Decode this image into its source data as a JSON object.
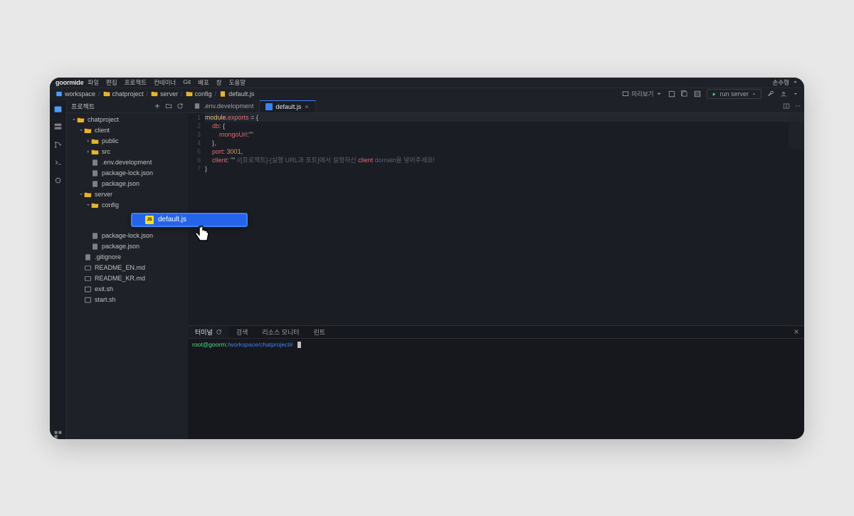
{
  "topbar": {
    "logo": "goormide",
    "menu": [
      "파일",
      "편집",
      "프로젝트",
      "컨테이너",
      "Git",
      "배포",
      "창",
      "도움말"
    ],
    "user": "손수형"
  },
  "breadcrumb": {
    "items": [
      {
        "icon": "container",
        "label": "workspace"
      },
      {
        "icon": "folder",
        "label": "chatproject"
      },
      {
        "icon": "folder",
        "label": "server"
      },
      {
        "icon": "folder",
        "label": "config"
      },
      {
        "icon": "file",
        "label": "default.js"
      }
    ]
  },
  "toolbar": {
    "preview": "미리보기",
    "run": "run server"
  },
  "sidebar": {
    "title": "프로젝트",
    "tree": [
      {
        "d": 0,
        "t": "folder",
        "open": true,
        "label": "chatproject"
      },
      {
        "d": 1,
        "t": "folder",
        "open": true,
        "label": "client"
      },
      {
        "d": 2,
        "t": "folder",
        "open": false,
        "label": "public"
      },
      {
        "d": 2,
        "t": "folder",
        "open": false,
        "label": "src"
      },
      {
        "d": 2,
        "t": "file",
        "label": ".env.development"
      },
      {
        "d": 2,
        "t": "file",
        "label": "package-lock.json"
      },
      {
        "d": 2,
        "t": "file",
        "label": "package.json"
      },
      {
        "d": 1,
        "t": "folder",
        "open": true,
        "label": "server"
      },
      {
        "d": 2,
        "t": "folder",
        "open": true,
        "label": "config"
      },
      {
        "d": 3,
        "t": "file",
        "label": "default.js",
        "selected": true
      },
      {
        "d": 2,
        "t": "file",
        "label": "package-lock.json"
      },
      {
        "d": 2,
        "t": "file",
        "label": "package.json"
      },
      {
        "d": 1,
        "t": "file",
        "label": ".gitignore"
      },
      {
        "d": 1,
        "t": "md",
        "label": "README_EN.md"
      },
      {
        "d": 1,
        "t": "md",
        "label": "README_KR.md"
      },
      {
        "d": 1,
        "t": "sh",
        "label": "exit.sh"
      },
      {
        "d": 1,
        "t": "sh",
        "label": "start.sh"
      }
    ]
  },
  "callout": {
    "label": "default.js"
  },
  "tabs": [
    {
      "label": ".env.development",
      "active": false
    },
    {
      "label": "default.js",
      "active": true
    }
  ],
  "code": {
    "lines": [
      "module.exports = {",
      "    db: {",
      "        mongoUrl:\"\"",
      "    },",
      "    port: 3001,",
      "    client: \"\" //[프로젝트]-[실행 URL과 포트]에서 설정하신 client domain을 넣어주세요!",
      "}"
    ]
  },
  "terminal": {
    "tabs": [
      "터미널",
      "검색",
      "리소스 모니터",
      "린트"
    ],
    "prompt_user": "root@goorm:",
    "prompt_path": "/workspace/chatproject#"
  }
}
